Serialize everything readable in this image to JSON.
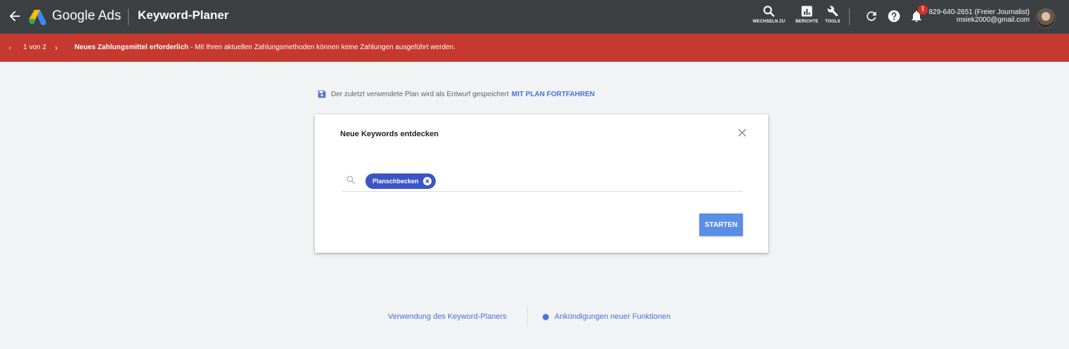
{
  "header": {
    "brand": "Google Ads",
    "title": "Keyword-Planer",
    "tools": [
      {
        "label": "WECHSELN ZU",
        "icon": "search-icon"
      },
      {
        "label": "BERICHTE",
        "icon": "reports-icon"
      },
      {
        "label": "TOOLS",
        "icon": "wrench-icon"
      }
    ],
    "notification_count": "!",
    "account_line1": "829-640-2651 (Freier Journalist)",
    "account_line2": "msiek2000@gmail.com"
  },
  "alert": {
    "counter": "1 von 2",
    "title": "Neues Zahlungsmittel erforderlich",
    "message": " - Mit Ihren aktuellen Zahlungsmethoden können keine Zahlungen ausgeführt werden."
  },
  "draft": {
    "text": "Der zuletzt verwendete Plan wird als Entwurf gespeichert",
    "link": "MIT PLAN FORTFAHREN"
  },
  "card": {
    "title": "Neue Keywords entdecken",
    "chip": "Planschbecken",
    "start_label": "STARTEN"
  },
  "footer": {
    "link1": "Verwendung des Keyword-Planers",
    "link2": "Ankündigungen neuer Funktionen"
  },
  "colors": {
    "topbar": "#3c4043",
    "alert": "#c5392f",
    "accent": "#4a70d9",
    "chip": "#3c55c5",
    "button": "#5b8ee6"
  }
}
